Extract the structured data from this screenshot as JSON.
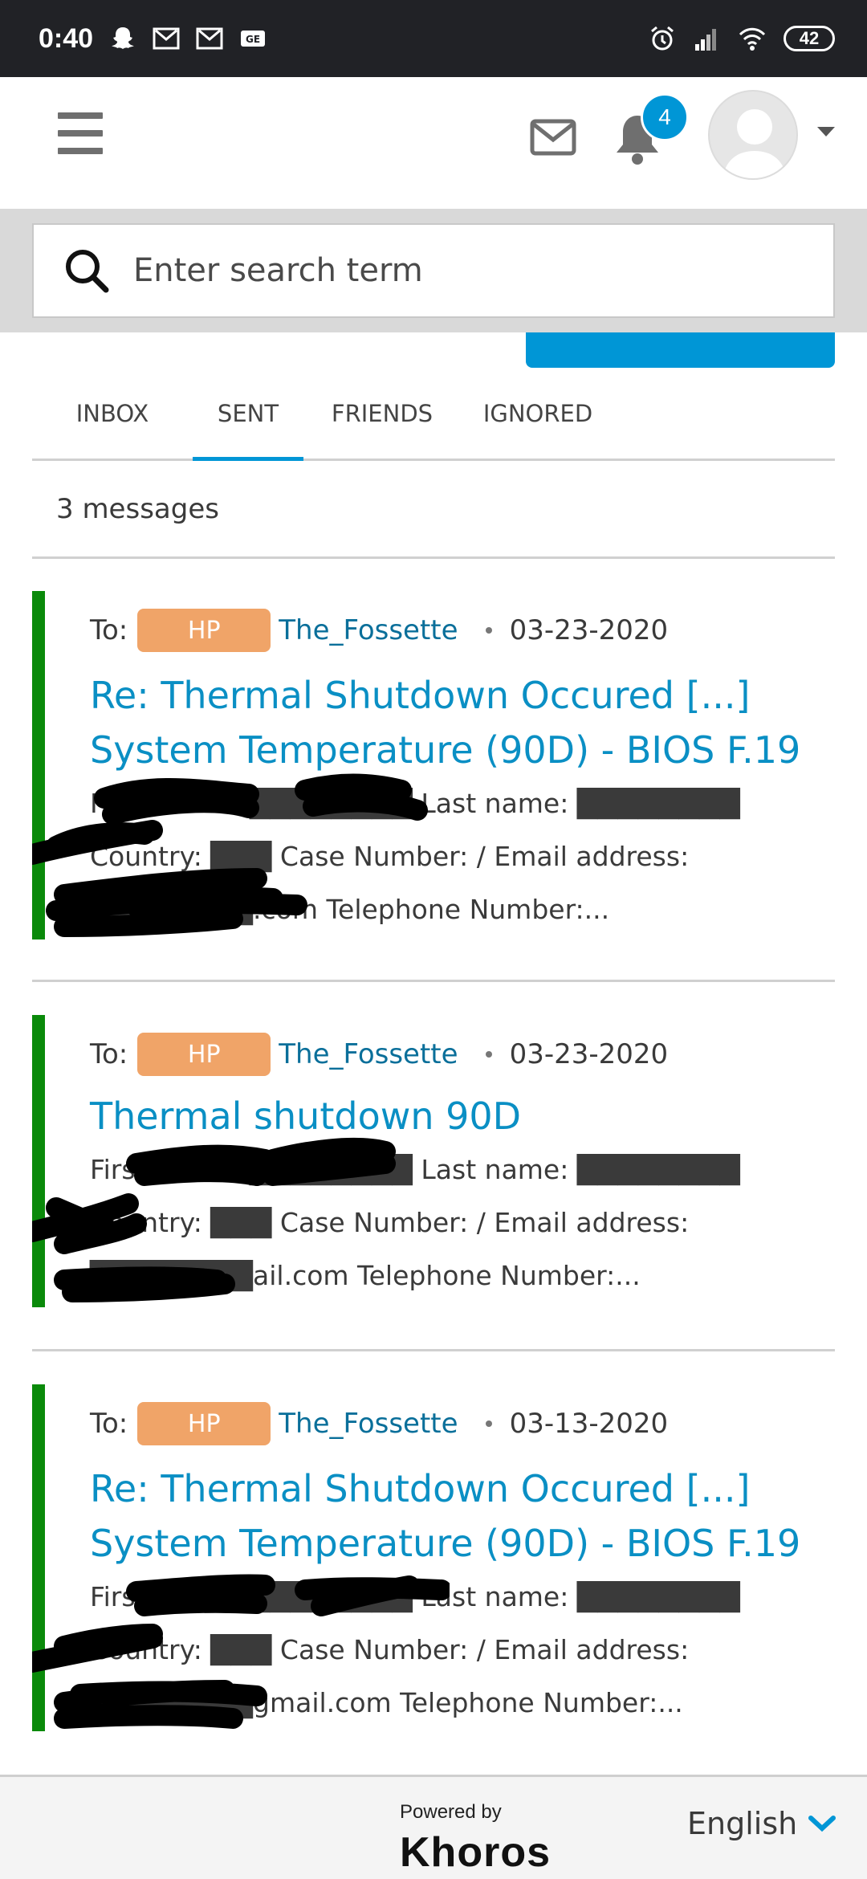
{
  "status_bar": {
    "time": "0:40",
    "battery": "42"
  },
  "header": {
    "notification_count": "4"
  },
  "search": {
    "placeholder": "Enter search term"
  },
  "tabs": [
    {
      "label": "INBOX"
    },
    {
      "label": "SENT"
    },
    {
      "label": "FRIENDS"
    },
    {
      "label": "IGNORED"
    }
  ],
  "active_tab": "SENT",
  "message_count": "3 messages",
  "messages": [
    {
      "to_label": "To:",
      "rank": "HP",
      "user": "The_Fossette",
      "date": "03-23-2020",
      "subject": "Re: Thermal Shutdown Occured [...] System Temperature (90D) - BIOS F.19",
      "body": "First Name: ████████ Last name: ████████ Country: ███ Case Number: / Email address: ████████.com Telephone Number:..."
    },
    {
      "to_label": "To:",
      "rank": "HP",
      "user": "The_Fossette",
      "date": "03-23-2020",
      "subject": "Thermal shutdown 90D",
      "body": "First Name: ████████ Last name: ████████ Country: ███ Case Number: / Email address: ████████ail.com Telephone Number:..."
    },
    {
      "to_label": "To:",
      "rank": "HP",
      "user": "The_Fossette",
      "date": "03-13-2020",
      "subject": "Re: Thermal Shutdown Occured [...] System Temperature (90D) - BIOS F.19",
      "body": "First Name: ████████ Last name: ████████ Country: ███ Case Number: / Email address: ████████gmail.com Telephone Number:..."
    }
  ],
  "footer": {
    "powered_by": "Powered by",
    "brand": "Khoros",
    "language": "English"
  },
  "colors": {
    "accent": "#0096d6",
    "link": "#0a8fc4",
    "rank_badge": "#f0a468",
    "message_bar": "#0a8a0a"
  }
}
